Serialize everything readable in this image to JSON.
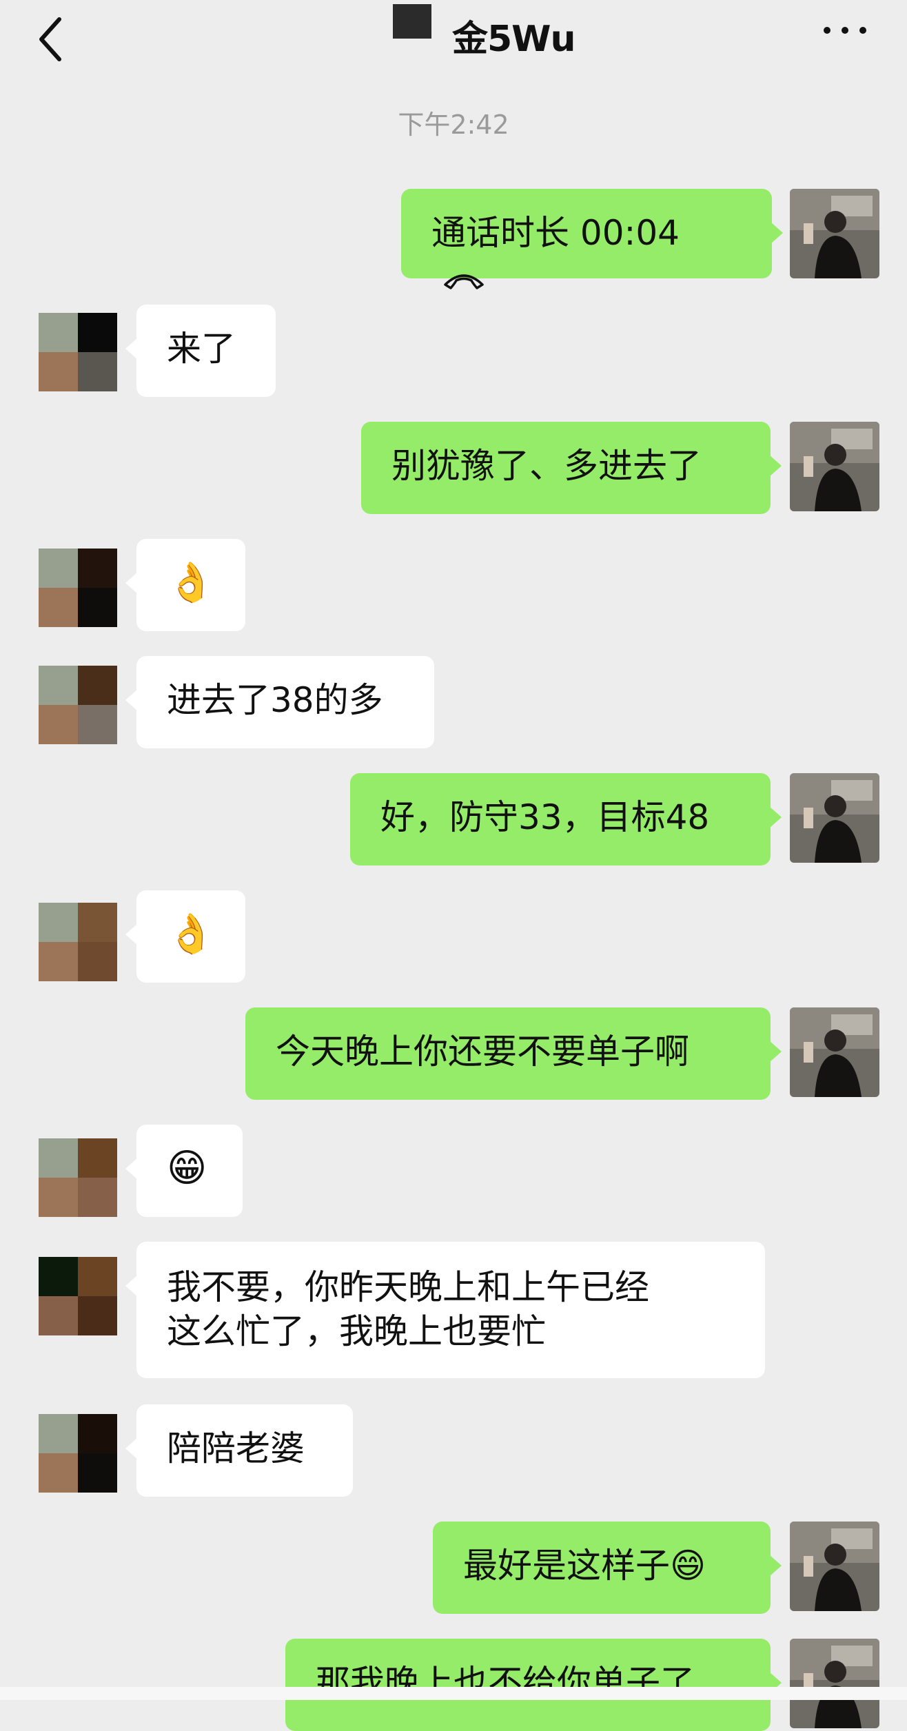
{
  "header": {
    "title": "金5Wu"
  },
  "timestamp": "下午2:42",
  "messages": [
    {
      "side": "right",
      "text": "通话时长 00:04",
      "icon": "phone-hangup-icon"
    },
    {
      "side": "left",
      "text": "来了"
    },
    {
      "side": "right",
      "text": "别犹豫了、多进去了"
    },
    {
      "side": "left",
      "text": "👌"
    },
    {
      "side": "left",
      "text": "进去了38的多"
    },
    {
      "side": "right",
      "text": "好，防守33，目标48"
    },
    {
      "side": "left",
      "text": "👌"
    },
    {
      "side": "right",
      "text": "今天晚上你还要不要单子啊"
    },
    {
      "side": "left",
      "text": "😁"
    },
    {
      "side": "left",
      "line1": "我不要，你昨天晚上和上午已经",
      "line2": "这么忙了，我晚上也要忙"
    },
    {
      "side": "left",
      "text": "陪陪老婆"
    },
    {
      "side": "right",
      "text": "最好是这样子😄"
    },
    {
      "side": "right",
      "text": "那我晚上也不给你单子了"
    }
  ],
  "colors": {
    "background": "#ededed",
    "sent_bubble": "#95ec69",
    "received_bubble": "#ffffff",
    "timestamp": "#9a9a9a"
  }
}
